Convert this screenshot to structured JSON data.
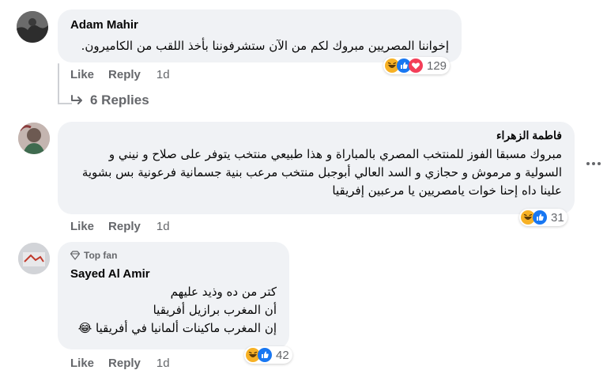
{
  "comments": [
    {
      "author": "Adam Mahir",
      "text": "إخواننا المصريين مبروك لكم من الآن ستشرفوننا بأخذ اللقب من الكاميرون.",
      "reaction_count": "129",
      "actions": {
        "like": "Like",
        "reply": "Reply",
        "time": "1d"
      },
      "replies_label": "6 Replies"
    },
    {
      "author": "فاطمة الزهراء",
      "text": "مبروك مسبقا الفوز للمنتخب المصري بالمباراة و هذا طبيعي منتخب يتوفر على صلاح و نيني و السولية و مرموش و حجازي و السد العالي أبوجبل منتخب مرعب بنية جسمانية فرعونية بس بشوية علينا داه إحنا خوات يامصريين يا مرعبين إفريقيا",
      "reaction_count": "31",
      "actions": {
        "like": "Like",
        "reply": "Reply",
        "time": "1d"
      }
    },
    {
      "badge": "Top fan",
      "author": "Sayed Al Amir",
      "lines": [
        "كتر من ده وذيد عليهم",
        "أن المغرب برازيل أفريقيا",
        "إن المغرب ماكينات ألمانيا في أفريقيا 😂"
      ],
      "reaction_count": "42",
      "actions": {
        "like": "Like",
        "reply": "Reply",
        "time": "1d"
      }
    }
  ],
  "icons": {
    "haha": "haha-emoji-icon",
    "like": "like-reaction-icon",
    "love": "love-reaction-icon",
    "reply_arrow": "reply-arrow-icon",
    "more": "more-options-icon",
    "badge": "top-fan-diamond-icon"
  },
  "colors": {
    "bubble": "#f0f2f5",
    "secondary_text": "#65676b",
    "like_blue": "#1877f2",
    "love_red": "#f33e58",
    "haha_yellow": "#f7b125"
  }
}
